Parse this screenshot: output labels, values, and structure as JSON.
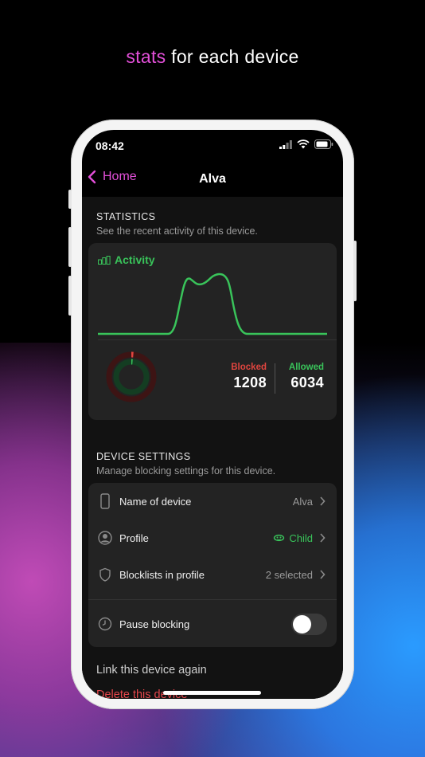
{
  "headline": {
    "accent": "stats",
    "rest": " for each device"
  },
  "status_bar": {
    "time": "08:42"
  },
  "nav": {
    "back_label": "Home",
    "title": "Alva"
  },
  "statistics": {
    "title": "STATISTICS",
    "subtitle": "See the recent activity of this device.",
    "activity_label": "Activity",
    "blocked_label": "Blocked",
    "blocked_value": "1208",
    "allowed_label": "Allowed",
    "allowed_value": "6034"
  },
  "colors": {
    "accent": "#e24fd8",
    "activity_green": "#39c35a",
    "blocked_red": "#e0453f",
    "danger": "#e5484d"
  },
  "device_settings": {
    "title": "DEVICE SETTINGS",
    "subtitle": "Manage blocking settings for this device.",
    "rows": [
      {
        "icon": "phone-icon",
        "label": "Name of device",
        "value": "Alva"
      },
      {
        "icon": "person-icon",
        "label": "Profile",
        "value": "Child"
      },
      {
        "icon": "shield-icon",
        "label": "Blocklists in profile",
        "value": "2 selected"
      }
    ],
    "pause": {
      "icon": "clock-icon",
      "label": "Pause blocking",
      "enabled": false
    }
  },
  "actions": {
    "link_again": "Link this device again",
    "delete": "Delete this device"
  }
}
